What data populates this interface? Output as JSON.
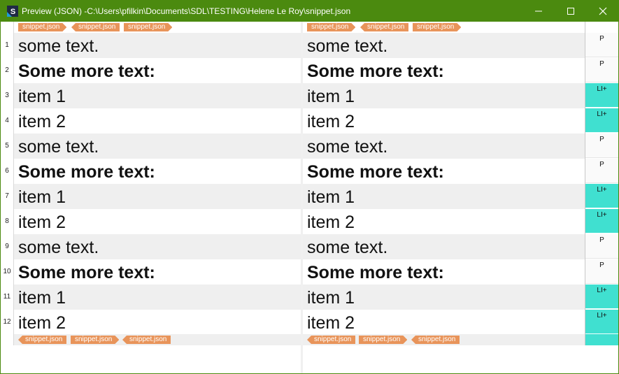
{
  "window": {
    "title": "Preview (JSON) -C:\\Users\\pfilkin\\Documents\\SDL\\TESTING\\Helene Le Roy\\snippet.json",
    "accent_color": "#4b8a0f",
    "controls": [
      "minimize-icon",
      "maximize-icon",
      "close-icon"
    ]
  },
  "colors": {
    "tag": "#e8945a",
    "li_style": "#40e0d0",
    "shaded_row": "#efefef"
  },
  "tags": {
    "left_top": [
      "snippet.json",
      "snippet.json",
      "snippet.json"
    ],
    "right_top": [
      "snippet.json",
      "snippet.json",
      "snippet.json"
    ],
    "left_bottom": [
      "snippet.json",
      "snippet.json",
      "snippet.json"
    ],
    "right_bottom": [
      "snippet.json",
      "snippet.json",
      "snippet.json"
    ]
  },
  "rows": [
    {
      "num": "1",
      "source": "some text.",
      "target": "some text.",
      "style": "P"
    },
    {
      "num": "2",
      "source": "Some more text:",
      "target": "Some more text:",
      "style": "P"
    },
    {
      "num": "3",
      "source": "item 1",
      "target": "item 1",
      "style": "LI+"
    },
    {
      "num": "4",
      "source": "item 2",
      "target": "item 2",
      "style": "LI+"
    },
    {
      "num": "5",
      "source": "some text.",
      "target": "some text.",
      "style": "P"
    },
    {
      "num": "6",
      "source": "Some more text:",
      "target": "Some more text:",
      "style": "P"
    },
    {
      "num": "7",
      "source": "item 1",
      "target": "item 1",
      "style": "LI+"
    },
    {
      "num": "8",
      "source": "item 2",
      "target": "item 2",
      "style": "LI+"
    },
    {
      "num": "9",
      "source": "some text.",
      "target": "some text.",
      "style": "P"
    },
    {
      "num": "10",
      "source": "Some more text:",
      "target": "Some more text:",
      "style": "P"
    },
    {
      "num": "11",
      "source": "item 1",
      "target": "item 1",
      "style": "LI+"
    },
    {
      "num": "12",
      "source": "item 2",
      "target": "item 2",
      "style": "LI+"
    }
  ]
}
